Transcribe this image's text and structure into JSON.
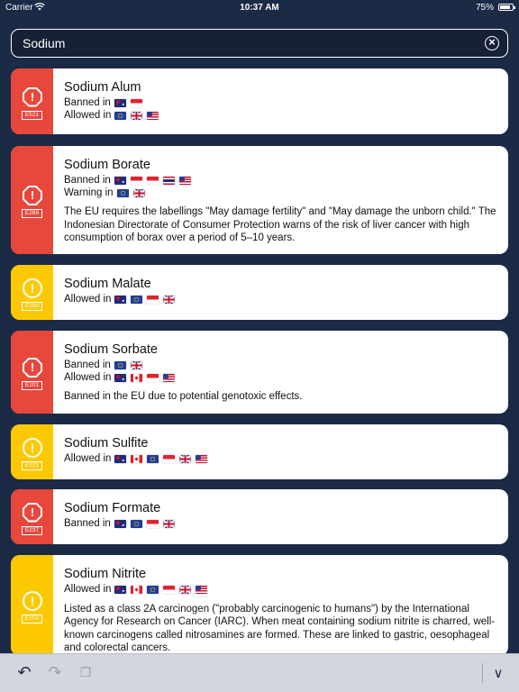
{
  "status_bar": {
    "carrier": "Carrier",
    "time": "10:37 AM",
    "battery": "75%",
    "battery_level": 0.75
  },
  "search": {
    "query": "Sodium",
    "clear_icon": "clear-circle-icon"
  },
  "items": [
    {
      "name": "Sodium Alum",
      "code": "E521",
      "level": "red",
      "rows": [
        {
          "label": "Banned in",
          "flags": [
            "au",
            "id"
          ]
        },
        {
          "label": "Allowed in",
          "flags": [
            "eu",
            "gb",
            "us"
          ]
        }
      ],
      "note": ""
    },
    {
      "name": "Sodium Borate",
      "code": "E285",
      "level": "red",
      "rows": [
        {
          "label": "Banned in",
          "flags": [
            "au",
            "id",
            "id",
            "th",
            "us"
          ]
        },
        {
          "label": "Warning in",
          "flags": [
            "eu",
            "gb"
          ]
        }
      ],
      "note": "The EU requires the labellings \"May damage fertility\" and \"May damage the unborn child.\" The Indonesian Directorate of Consumer Protection warns of the risk of liver cancer with high consumption of borax over a period of 5–10 years."
    },
    {
      "name": "Sodium Malate",
      "code": "E350",
      "level": "yellow",
      "rows": [
        {
          "label": "Allowed in",
          "flags": [
            "au",
            "eu",
            "id",
            "gb"
          ]
        }
      ],
      "note": ""
    },
    {
      "name": "Sodium Sorbate",
      "code": "E201",
      "level": "red",
      "rows": [
        {
          "label": "Banned in",
          "flags": [
            "eu",
            "gb"
          ]
        },
        {
          "label": "Allowed in",
          "flags": [
            "au",
            "ca",
            "id",
            "us"
          ]
        }
      ],
      "note": "Banned in the EU due to potential genotoxic effects."
    },
    {
      "name": "Sodium Sulfite",
      "code": "E221",
      "level": "yellow",
      "rows": [
        {
          "label": "Allowed in",
          "flags": [
            "au",
            "ca",
            "eu",
            "id",
            "gb",
            "us"
          ]
        }
      ],
      "note": ""
    },
    {
      "name": "Sodium Formate",
      "code": "E237",
      "level": "red",
      "rows": [
        {
          "label": "Banned in",
          "flags": [
            "au",
            "eu",
            "id",
            "gb"
          ]
        }
      ],
      "note": ""
    },
    {
      "name": "Sodium Nitrite",
      "code": "E250",
      "level": "yellow",
      "rows": [
        {
          "label": "Allowed in",
          "flags": [
            "au",
            "ca",
            "eu",
            "id",
            "gb",
            "us"
          ]
        }
      ],
      "note": "Listed as a class 2A carcinogen (\"probably carcinogenic to humans\") by the International Agency for Research on Cancer (IARC). When meat containing sodium nitrite is charred, well-known carcinogens called nitrosamines are formed. These are linked to gastric, oesophageal and colorectal cancers."
    }
  ],
  "toolbar": {
    "undo_icon": "undo-icon",
    "redo_icon": "redo-icon",
    "paste_icon": "paste-icon",
    "dismiss_icon": "chevron-down-icon"
  }
}
